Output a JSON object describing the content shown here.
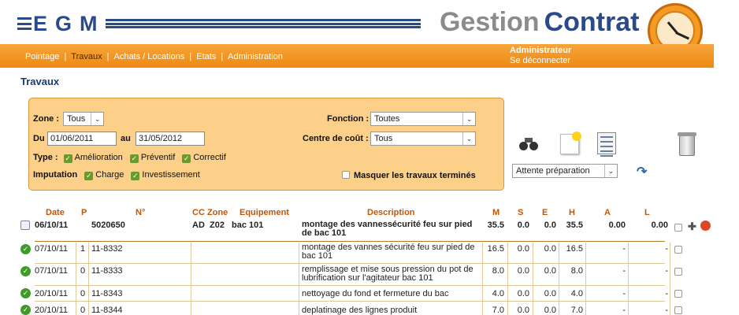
{
  "header": {
    "logo_text": "EGM",
    "brand_part1": "Gestion",
    "brand_part2": "Contrat"
  },
  "nav": {
    "items": [
      "Pointage",
      "Travaux",
      "Achats / Locations",
      "Etats",
      "Administration"
    ],
    "active": "Travaux",
    "user_role": "Administrateur",
    "logout_label": "Se déconnecter"
  },
  "page_title": "Travaux",
  "filter": {
    "zone_label": "Zone :",
    "zone_value": "Tous",
    "du_label": "Du",
    "date_from": "01/06/2011",
    "au_label": "au",
    "date_to": "31/05/2012",
    "type_label": "Type :",
    "type_options": [
      "Amélioration",
      "Préventif",
      "Correctif"
    ],
    "imputation_label": "Imputation",
    "imputation_options": [
      "Charge",
      "Investissement"
    ],
    "fonction_label": "Fonction :",
    "fonction_value": "Toutes",
    "centre_label": "Centre de coût :",
    "centre_value": "Tous",
    "masquer_label": "Masquer les travaux terminés"
  },
  "toolbar": {
    "status_value": "Attente préparation",
    "icons": [
      "binoculars-icon",
      "new-document-icon",
      "spreadsheet-icon",
      "trash-icon",
      "refresh-icon"
    ]
  },
  "table": {
    "headers": {
      "date": "Date",
      "p": "P",
      "num": "N°",
      "cc": "CC",
      "zone": "Zone",
      "equipement": "Equipement",
      "description": "Description",
      "m": "M",
      "s": "S",
      "e": "E",
      "h": "H",
      "a": "A",
      "l": "L"
    },
    "summary": {
      "date": "06/10/11",
      "num": "5020650",
      "cc": "AD",
      "zone": "Z02",
      "equipement": "bac 101",
      "description": "montage des vannessécurité feu sur pied de bac 101",
      "m": "35.5",
      "s": "0.0",
      "e": "0.0",
      "h": "35.5",
      "a": "0.00",
      "l": "0.00"
    },
    "rows": [
      {
        "date": "07/10/11",
        "p": "1",
        "num": "11-8332",
        "description": "montage des vannes sécurité feu sur pied de bac 101",
        "m": "16.5",
        "s": "0.0",
        "e": "0.0",
        "h": "16.5",
        "a": "-",
        "l": "-"
      },
      {
        "date": "07/10/11",
        "p": "0",
        "num": "11-8333",
        "description": "remplissage et mise sous pression du pot de lubrification sur l'agitateur bac 101",
        "m": "8.0",
        "s": "0.0",
        "e": "0.0",
        "h": "8.0",
        "a": "-",
        "l": "-"
      },
      {
        "date": "20/10/11",
        "p": "0",
        "num": "11-8343",
        "description": "nettoyage du fond et fermeture du bac",
        "m": "4.0",
        "s": "0.0",
        "e": "0.0",
        "h": "4.0",
        "a": "-",
        "l": "-"
      },
      {
        "date": "20/10/11",
        "p": "0",
        "num": "11-8344",
        "description": "deplatinage des lignes produit",
        "m": "7.0",
        "s": "0.0",
        "e": "0.0",
        "h": "7.0",
        "a": "-",
        "l": "-"
      }
    ]
  },
  "colors": {
    "nav_orange": "#ee8a12",
    "filter_bg": "#fcd089",
    "header_text": "#c0560a",
    "brand_blue": "#2a4a8a",
    "status_green": "#3f9a2a"
  }
}
